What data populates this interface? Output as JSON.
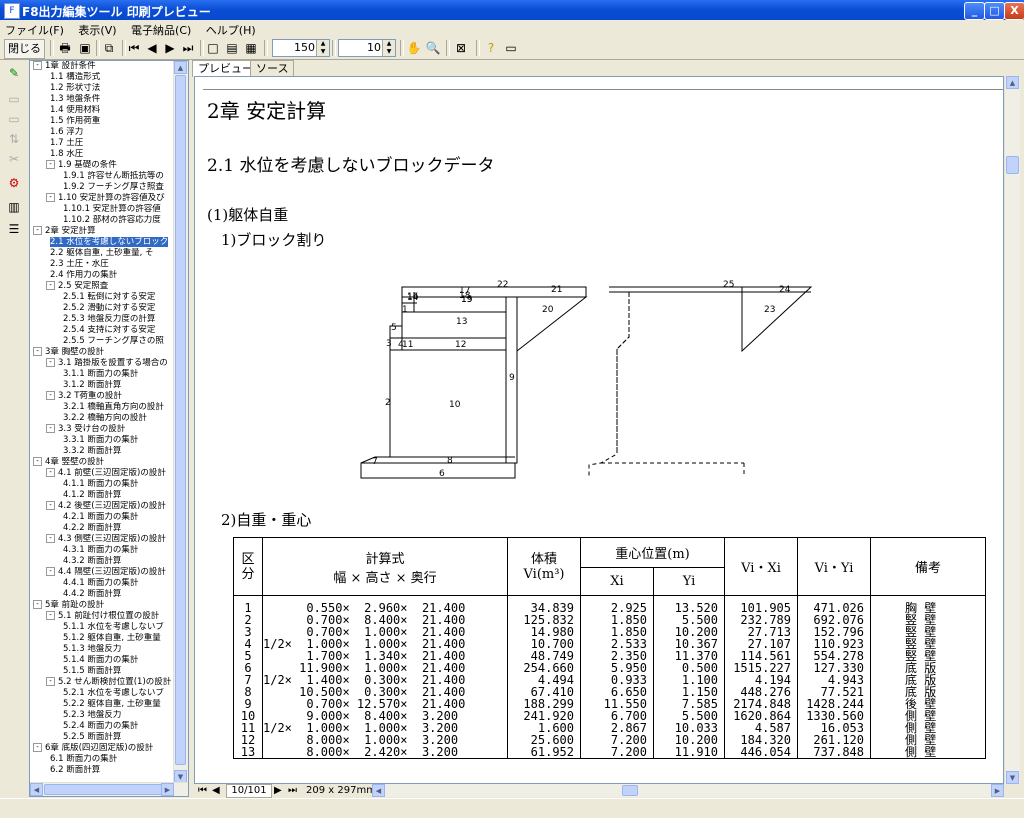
{
  "window": {
    "title": "F8出力編集ツール 印刷プレビュー",
    "min": "_",
    "max": "□",
    "close": "X"
  },
  "menu": [
    "ファイル(F)",
    "表示(V)",
    "電子納品(C)",
    "ヘルプ(H)"
  ],
  "toolbar": {
    "close_label": "閉じる",
    "zoom_value": "150",
    "page_step_value": "10"
  },
  "tree": {
    "items": [
      {
        "label": "1章 設計条件",
        "level": 0,
        "toggle": "-"
      },
      {
        "label": "1.1 構造形式",
        "level": 1
      },
      {
        "label": "1.2 形状寸法",
        "level": 1
      },
      {
        "label": "1.3 地盤条件",
        "level": 1
      },
      {
        "label": "1.4 使用材料",
        "level": 1
      },
      {
        "label": "1.5 作用荷重",
        "level": 1
      },
      {
        "label": "1.6 浮力",
        "level": 1
      },
      {
        "label": "1.7 土圧",
        "level": 1
      },
      {
        "label": "1.8 水圧",
        "level": 1
      },
      {
        "label": "1.9 基礎の条件",
        "level": 1,
        "toggle": "-"
      },
      {
        "label": "1.9.1 許容せん断抵抗等の",
        "level": 2
      },
      {
        "label": "1.9.2 フーチング厚さ照査",
        "level": 2
      },
      {
        "label": "1.10 安定計算の許容値及び",
        "level": 1,
        "toggle": "-"
      },
      {
        "label": "1.10.1 安定計算の許容値",
        "level": 2
      },
      {
        "label": "1.10.2 部材の許容応力度",
        "level": 2
      },
      {
        "label": "2章 安定計算",
        "level": 0,
        "toggle": "-"
      },
      {
        "label": "2.1 水位を考慮しないブロック",
        "level": 1,
        "selected": true
      },
      {
        "label": "2.2 躯体自重, 土砂重量, そ",
        "level": 1
      },
      {
        "label": "2.3 土圧・水圧",
        "level": 1
      },
      {
        "label": "2.4 作用力の集計",
        "level": 1
      },
      {
        "label": "2.5 安定照査",
        "level": 1,
        "toggle": "-"
      },
      {
        "label": "2.5.1 転倒に対する安定",
        "level": 2
      },
      {
        "label": "2.5.2 滑動に対する安定",
        "level": 2
      },
      {
        "label": "2.5.3 地盤反力度の計算",
        "level": 2
      },
      {
        "label": "2.5.4 支持に対する安定",
        "level": 2
      },
      {
        "label": "2.5.5 フーチング厚さの照",
        "level": 2
      },
      {
        "label": "3章 胸壁の設計",
        "level": 0,
        "toggle": "-"
      },
      {
        "label": "3.1 踏掛版を設置する場合の",
        "level": 1,
        "toggle": "-"
      },
      {
        "label": "3.1.1 断面力の集計",
        "level": 2
      },
      {
        "label": "3.1.2 断面計算",
        "level": 2
      },
      {
        "label": "3.2 T荷重の設計",
        "level": 1,
        "toggle": "-"
      },
      {
        "label": "3.2.1 橋軸直角方向の設計",
        "level": 2
      },
      {
        "label": "3.2.2 橋軸方向の設計",
        "level": 2
      },
      {
        "label": "3.3 受け台の設計",
        "level": 1,
        "toggle": "-"
      },
      {
        "label": "3.3.1 断面力の集計",
        "level": 2
      },
      {
        "label": "3.3.2 断面計算",
        "level": 2
      },
      {
        "label": "4章 竪壁の設計",
        "level": 0,
        "toggle": "-"
      },
      {
        "label": "4.1 前壁(三辺固定版)の設計",
        "level": 1,
        "toggle": "-"
      },
      {
        "label": "4.1.1 断面力の集計",
        "level": 2
      },
      {
        "label": "4.1.2 断面計算",
        "level": 2
      },
      {
        "label": "4.2 後壁(三辺固定版)の設計",
        "level": 1,
        "toggle": "-"
      },
      {
        "label": "4.2.1 断面力の集計",
        "level": 2
      },
      {
        "label": "4.2.2 断面計算",
        "level": 2
      },
      {
        "label": "4.3 側壁(三辺固定版)の設計",
        "level": 1,
        "toggle": "-"
      },
      {
        "label": "4.3.1 断面力の集計",
        "level": 2
      },
      {
        "label": "4.3.2 断面計算",
        "level": 2
      },
      {
        "label": "4.4 隔壁(三辺固定版)の設計",
        "level": 1,
        "toggle": "-"
      },
      {
        "label": "4.4.1 断面力の集計",
        "level": 2
      },
      {
        "label": "4.4.2 断面計算",
        "level": 2
      },
      {
        "label": "5章 前趾の設計",
        "level": 0,
        "toggle": "-"
      },
      {
        "label": "5.1 前趾付け根位置の設計",
        "level": 1,
        "toggle": "-"
      },
      {
        "label": "5.1.1 水位を考慮しないブ",
        "level": 2
      },
      {
        "label": "5.1.2 躯体自重, 土砂重量",
        "level": 2
      },
      {
        "label": "5.1.3 地盤反力",
        "level": 2
      },
      {
        "label": "5.1.4 断面力の集計",
        "level": 2
      },
      {
        "label": "5.1.5 断面計算",
        "level": 2
      },
      {
        "label": "5.2 せん断検討位置(1)の設計",
        "level": 1,
        "toggle": "-"
      },
      {
        "label": "5.2.1 水位を考慮しないブ",
        "level": 2
      },
      {
        "label": "5.2.2 躯体自重, 土砂重量",
        "level": 2
      },
      {
        "label": "5.2.3 地盤反力",
        "level": 2
      },
      {
        "label": "5.2.4 断面力の集計",
        "level": 2
      },
      {
        "label": "5.2.5 断面計算",
        "level": 2
      },
      {
        "label": "6章 底版(四辺固定版)の設計",
        "level": 0,
        "toggle": "-"
      },
      {
        "label": "6.1 断面力の集計",
        "level": 1
      },
      {
        "label": "6.2 断面計算",
        "level": 1
      }
    ]
  },
  "tabs": [
    {
      "label": "プレビュー",
      "active": true
    },
    {
      "label": "ソース",
      "active": false
    }
  ],
  "doc": {
    "chapter": "2章 安定計算",
    "section": "2.1 水位を考慮しないブロックデータ",
    "sub1": "(1)躯体自重",
    "sub1a": "1)ブロック割り",
    "sub1b": "2)自重・重心",
    "diagram_labels": [
      "1",
      "2",
      "3",
      "4",
      "5",
      "6",
      "7",
      "8",
      "9",
      "10",
      "11",
      "12",
      "13",
      "14",
      "15",
      "16",
      "17",
      "18",
      "19",
      "20",
      "21",
      "22",
      "23",
      "24",
      "25"
    ],
    "table": {
      "h_kubun": "区\n分",
      "h_formula_top": "計算式",
      "h_formula_bottom": "幅 × 高さ × 奥行",
      "h_volume": "体積\nVi(m³)",
      "h_centroid": "重心位置(m)",
      "h_xi": "Xi",
      "h_yi": "Yi",
      "h_vixi": "Vi・Xi",
      "h_viyi": "Vi・Yi",
      "h_note": "備考",
      "rows": [
        {
          "k": "1",
          "f": "      0.550×  2.960×  21.400",
          "v": "34.839",
          "x": "2.925",
          "y": "13.520",
          "vx": "101.905",
          "vy": "471.026",
          "n": "胸 壁"
        },
        {
          "k": "2",
          "f": "      0.700×  8.400×  21.400",
          "v": "125.832",
          "x": "1.850",
          "y": "5.500",
          "vx": "232.789",
          "vy": "692.076",
          "n": "竪 壁"
        },
        {
          "k": "3",
          "f": "      0.700×  1.000×  21.400",
          "v": "14.980",
          "x": "1.850",
          "y": "10.200",
          "vx": "27.713",
          "vy": "152.796",
          "n": "竪 壁"
        },
        {
          "k": "4",
          "f": "1/2×  1.000×  1.000×  21.400",
          "v": "10.700",
          "x": "2.533",
          "y": "10.367",
          "vx": "27.107",
          "vy": "110.923",
          "n": "竪 壁"
        },
        {
          "k": "5",
          "f": "      1.700×  1.340×  21.400",
          "v": "48.749",
          "x": "2.350",
          "y": "11.370",
          "vx": "114.561",
          "vy": "554.278",
          "n": "竪 壁"
        },
        {
          "k": "6",
          "f": "     11.900×  1.000×  21.400",
          "v": "254.660",
          "x": "5.950",
          "y": "0.500",
          "vx": "1515.227",
          "vy": "127.330",
          "n": "底 版"
        },
        {
          "k": "7",
          "f": "1/2×  1.400×  0.300×  21.400",
          "v": "4.494",
          "x": "0.933",
          "y": "1.100",
          "vx": "4.194",
          "vy": "4.943",
          "n": "底 版"
        },
        {
          "k": "8",
          "f": "     10.500×  0.300×  21.400",
          "v": "67.410",
          "x": "6.650",
          "y": "1.150",
          "vx": "448.276",
          "vy": "77.521",
          "n": "底 版"
        },
        {
          "k": "9",
          "f": "      0.700× 12.570×  21.400",
          "v": "188.299",
          "x": "11.550",
          "y": "7.585",
          "vx": "2174.848",
          "vy": "1428.244",
          "n": "後 壁"
        },
        {
          "k": "10",
          "f": "      9.000×  8.400×  3.200",
          "v": "241.920",
          "x": "6.700",
          "y": "5.500",
          "vx": "1620.864",
          "vy": "1330.560",
          "n": "側 壁"
        },
        {
          "k": "11",
          "f": "1/2×  1.000×  1.000×  3.200",
          "v": "1.600",
          "x": "2.867",
          "y": "10.033",
          "vx": "4.587",
          "vy": "16.053",
          "n": "側 壁"
        },
        {
          "k": "12",
          "f": "      8.000×  1.000×  3.200",
          "v": "25.600",
          "x": "7.200",
          "y": "10.200",
          "vx": "184.320",
          "vy": "261.120",
          "n": "側 壁"
        },
        {
          "k": "13",
          "f": "      8.000×  2.420×  3.200",
          "v": "61.952",
          "x": "7.200",
          "y": "11.910",
          "vx": "446.054",
          "vy": "737.848",
          "n": "側 壁"
        }
      ]
    }
  },
  "status": {
    "page": "10/101",
    "paper": "209 x 297mm"
  }
}
